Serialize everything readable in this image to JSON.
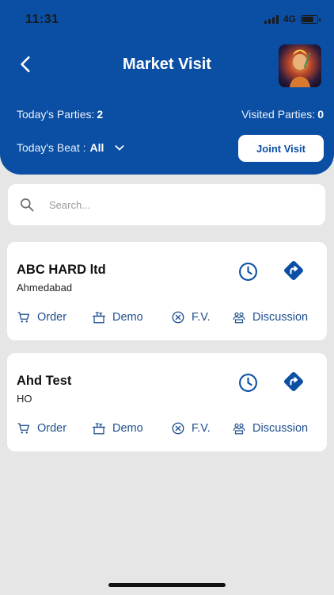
{
  "status_bar": {
    "time": "11:31",
    "network": "4G"
  },
  "header": {
    "title": "Market Visit",
    "todays_parties_label": "Today's Parties:",
    "todays_parties_value": "2",
    "visited_parties_label": "Visited Parties:",
    "visited_parties_value": "0",
    "beat_label": "Today's Beat :",
    "beat_value": "All",
    "joint_visit_label": "Joint Visit"
  },
  "search": {
    "placeholder": "Search..."
  },
  "parties": [
    {
      "name": "ABC HARD ltd",
      "location": "Ahmedabad",
      "actions": {
        "order": "Order",
        "demo": "Demo",
        "fv": "F.V.",
        "discussion": "Discussion"
      }
    },
    {
      "name": "Ahd Test",
      "location": "HO",
      "actions": {
        "order": "Order",
        "demo": "Demo",
        "fv": "F.V.",
        "discussion": "Discussion"
      }
    }
  ],
  "colors": {
    "primary": "#0b4fa4",
    "action_text": "#1e4f8f",
    "background": "#e6e6e6"
  },
  "icons": [
    "back-arrow-icon",
    "chevron-down-icon",
    "search-icon",
    "clock-icon",
    "direction-icon",
    "cart-icon",
    "demo-icon",
    "cancel-circle-icon",
    "discussion-icon"
  ]
}
